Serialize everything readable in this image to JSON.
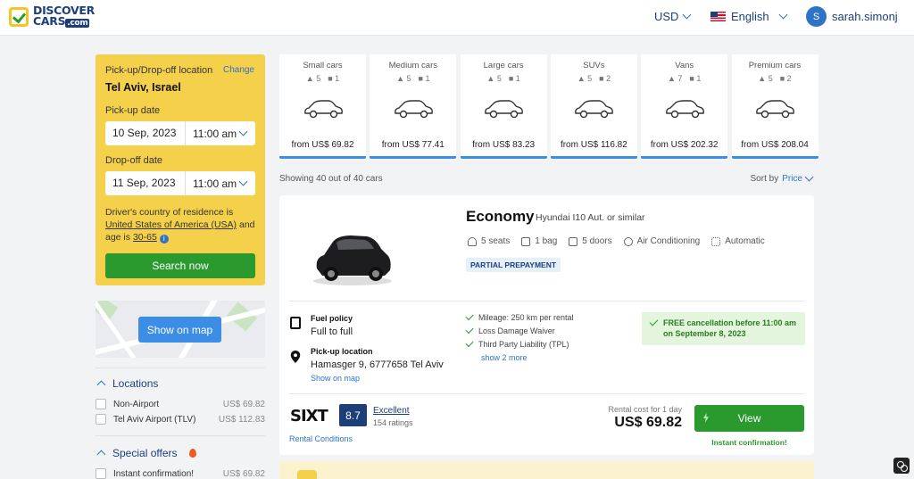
{
  "header": {
    "logo_line1": "DISCOVER",
    "logo_line2": "CARS",
    "logo_com": ".com",
    "currency": "USD",
    "language": "English",
    "user_initial": "S",
    "username": "sarah.simonj"
  },
  "search": {
    "location_label": "Pick-up/Drop-off location",
    "change_link": "Change",
    "location": "Tel Aviv, Israel",
    "pickup_label": "Pick-up date",
    "pickup_date": "10 Sep, 2023",
    "pickup_time": "11:00 am",
    "dropoff_label": "Drop-off date",
    "dropoff_date": "11 Sep, 2023",
    "dropoff_time": "11:00 am",
    "residence_text": "Driver's country of residence is",
    "residence_country": "United States of America (USA)",
    "age_text": "and age is",
    "age_range": "30-65",
    "info_icon_text": "i",
    "search_button": "Search now"
  },
  "map": {
    "button": "Show on map"
  },
  "filters": {
    "locations_title": "Locations",
    "locations": [
      {
        "label": "Non-Airport",
        "price": "US$ 69.82"
      },
      {
        "label": "Tel Aviv Airport (TLV)",
        "price": "US$ 112.83"
      }
    ],
    "special_title": "Special offers",
    "special": [
      {
        "label": "Instant confirmation!",
        "price": "US$ 69.82"
      }
    ]
  },
  "categories": [
    {
      "name": "Small cars",
      "seats": "5",
      "bags": "1",
      "price": "from US$ 69.82"
    },
    {
      "name": "Medium cars",
      "seats": "5",
      "bags": "1",
      "price": "from US$ 77.41"
    },
    {
      "name": "Large cars",
      "seats": "5",
      "bags": "1",
      "price": "from US$ 83.23"
    },
    {
      "name": "SUVs",
      "seats": "5",
      "bags": "2",
      "price": "from US$ 116.82"
    },
    {
      "name": "Vans",
      "seats": "7",
      "bags": "1",
      "price": "from US$ 202.32"
    },
    {
      "name": "Premium cars",
      "seats": "5",
      "bags": "2",
      "price": "from US$ 208.04"
    }
  ],
  "results": {
    "showing": "Showing 40 out of 40 cars",
    "sort_label": "Sort by",
    "sort_value": "Price"
  },
  "card": {
    "title": "Economy",
    "subtitle": "Hyundai I10 Aut. or similar",
    "features": [
      "5 seats",
      "1 bag",
      "5 doors",
      "Air Conditioning",
      "Automatic"
    ],
    "badge": "PARTIAL PREPAYMENT",
    "fuel_head": "Fuel policy",
    "fuel_value": "Full to full",
    "pickup_head": "Pick-up location",
    "pickup_value": "Hamasger 9, 6777658 Tel Aviv",
    "show_on_map": "Show on map",
    "checks": [
      "Mileage: 250 km per rental",
      "Loss Damage Waiver",
      "Third Party Liability (TPL)"
    ],
    "show_more": "show 2 more",
    "free_cancel": "FREE cancellation before 11:00 am on September 8, 2023",
    "supplier": "SIXT",
    "score": "8.7",
    "rating_text": "Excellent",
    "rating_count": "154 ratings",
    "rental_conditions": "Rental Conditions",
    "cost_label": "Rental cost for 1 day",
    "cost_value": "US$ 69.82",
    "view_button": "View",
    "instant": "Instant confirmation!"
  },
  "colors": {
    "brand_blue": "#1c3f7a",
    "accent_yellow": "#f5d04a",
    "action_green": "#2b9a2e",
    "link_blue": "#2e73c7"
  }
}
